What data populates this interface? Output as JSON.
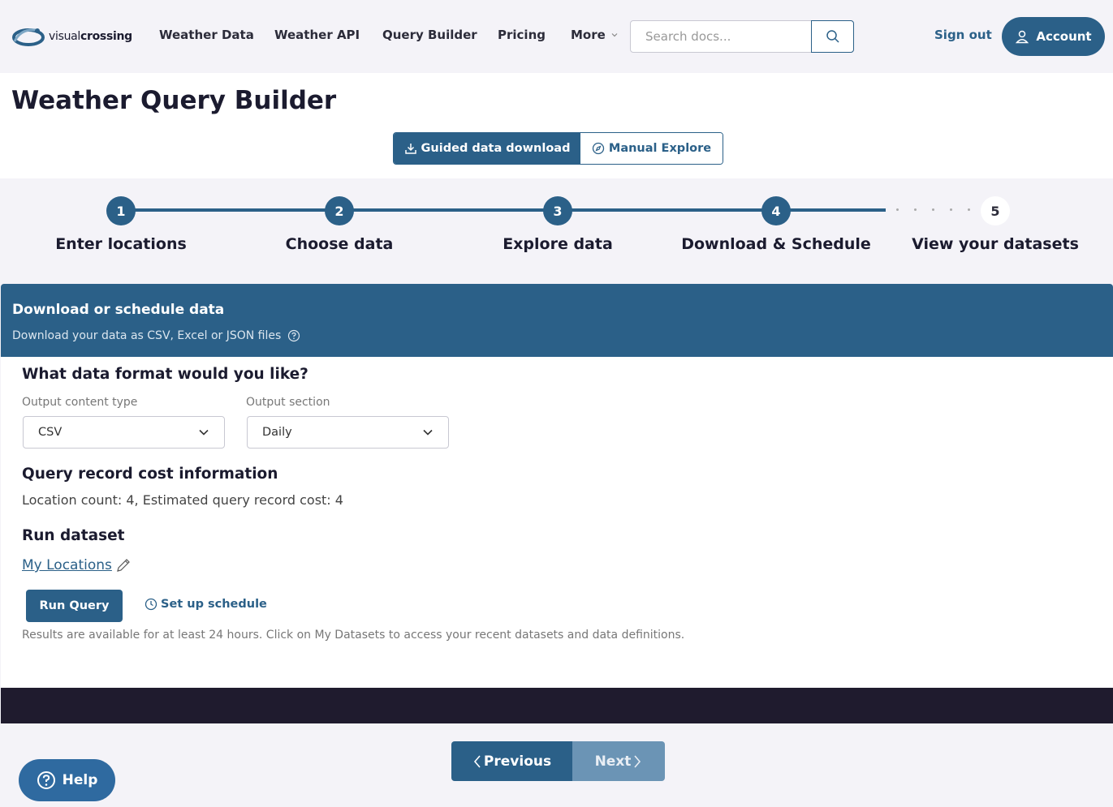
{
  "brand": {
    "name_light": "visual",
    "name_bold": "crossing"
  },
  "nav": {
    "items": [
      {
        "label": "Weather Data"
      },
      {
        "label": "Weather API"
      },
      {
        "label": "Query Builder"
      },
      {
        "label": "Pricing"
      },
      {
        "label": "More"
      }
    ],
    "search_placeholder": "Search docs...",
    "signout_label": "Sign out",
    "account_label": "Account"
  },
  "page": {
    "title": "Weather Query Builder",
    "modes": {
      "guided": "Guided data download",
      "manual": "Manual Explore"
    }
  },
  "stepper": {
    "steps": [
      {
        "number": "1",
        "label": "Enter locations",
        "state": "complete"
      },
      {
        "number": "2",
        "label": "Choose data",
        "state": "complete"
      },
      {
        "number": "3",
        "label": "Explore data",
        "state": "complete"
      },
      {
        "number": "4",
        "label": "Download & Schedule",
        "state": "current"
      },
      {
        "number": "5",
        "label": "View your datasets",
        "state": "pending"
      }
    ]
  },
  "card": {
    "title": "Download or schedule data",
    "subtitle": "Download your data as CSV, Excel or JSON files"
  },
  "format": {
    "heading": "What data format would you like?",
    "content_type_label": "Output content type",
    "content_type_value": "CSV",
    "section_label": "Output section",
    "section_value": "Daily"
  },
  "cost": {
    "heading": "Query record cost information",
    "text": "Location count: 4, Estimated query record cost: 4"
  },
  "run": {
    "heading": "Run dataset",
    "dataset_name": "My Locations",
    "run_label": "Run Query",
    "schedule_label": "Set up schedule",
    "note": "Results are available for at least 24 hours. Click on My Datasets to access your recent datasets and data definitions."
  },
  "footer_nav": {
    "previous_label": "Previous",
    "next_label": "Next"
  },
  "help": {
    "label": "Help"
  },
  "colors": {
    "primary": "#2b6088",
    "background": "#f4f3f8",
    "dark_bar": "#1f1b2e"
  }
}
